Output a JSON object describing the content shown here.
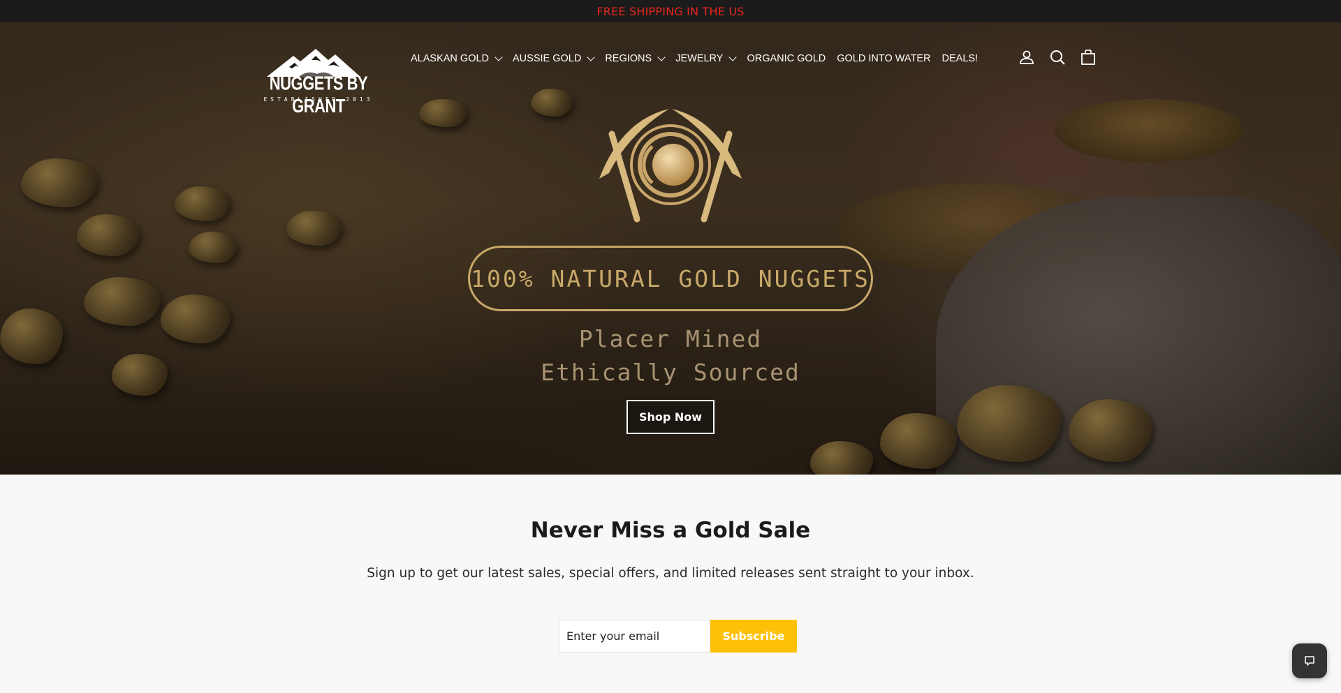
{
  "announcement": {
    "text": "FREE SHIPPING IN THE US"
  },
  "logo": {
    "name": "NUGGETS BY GRANT",
    "tagline": "ESTABLISHED-2013"
  },
  "nav": {
    "items": [
      {
        "label": "ALASKAN GOLD",
        "dropdown": true
      },
      {
        "label": "AUSSIE GOLD",
        "dropdown": true
      },
      {
        "label": "REGIONS",
        "dropdown": true
      },
      {
        "label": "JEWELRY",
        "dropdown": true
      },
      {
        "label": "ORGANIC GOLD",
        "dropdown": false
      },
      {
        "label": "GOLD INTO WATER",
        "dropdown": false
      },
      {
        "label": "DEALS!",
        "dropdown": false
      }
    ]
  },
  "header_icons": [
    "account-icon",
    "search-icon",
    "cart-icon"
  ],
  "hero": {
    "headline": "100% NATURAL GOLD NUGGETS",
    "line1": "Placer Mined",
    "line2": "Ethically Sourced",
    "button": "Shop Now"
  },
  "newsletter": {
    "title": "Never Miss a Gold Sale",
    "subtitle": "Sign up to get our latest sales, special offers, and limited releases sent straight to your inbox.",
    "placeholder": "Enter your email",
    "button": "Subscribe"
  },
  "colors": {
    "announcement_text": "#e8271f",
    "gold": "#c8a969",
    "subscribe": "#ffc107"
  }
}
